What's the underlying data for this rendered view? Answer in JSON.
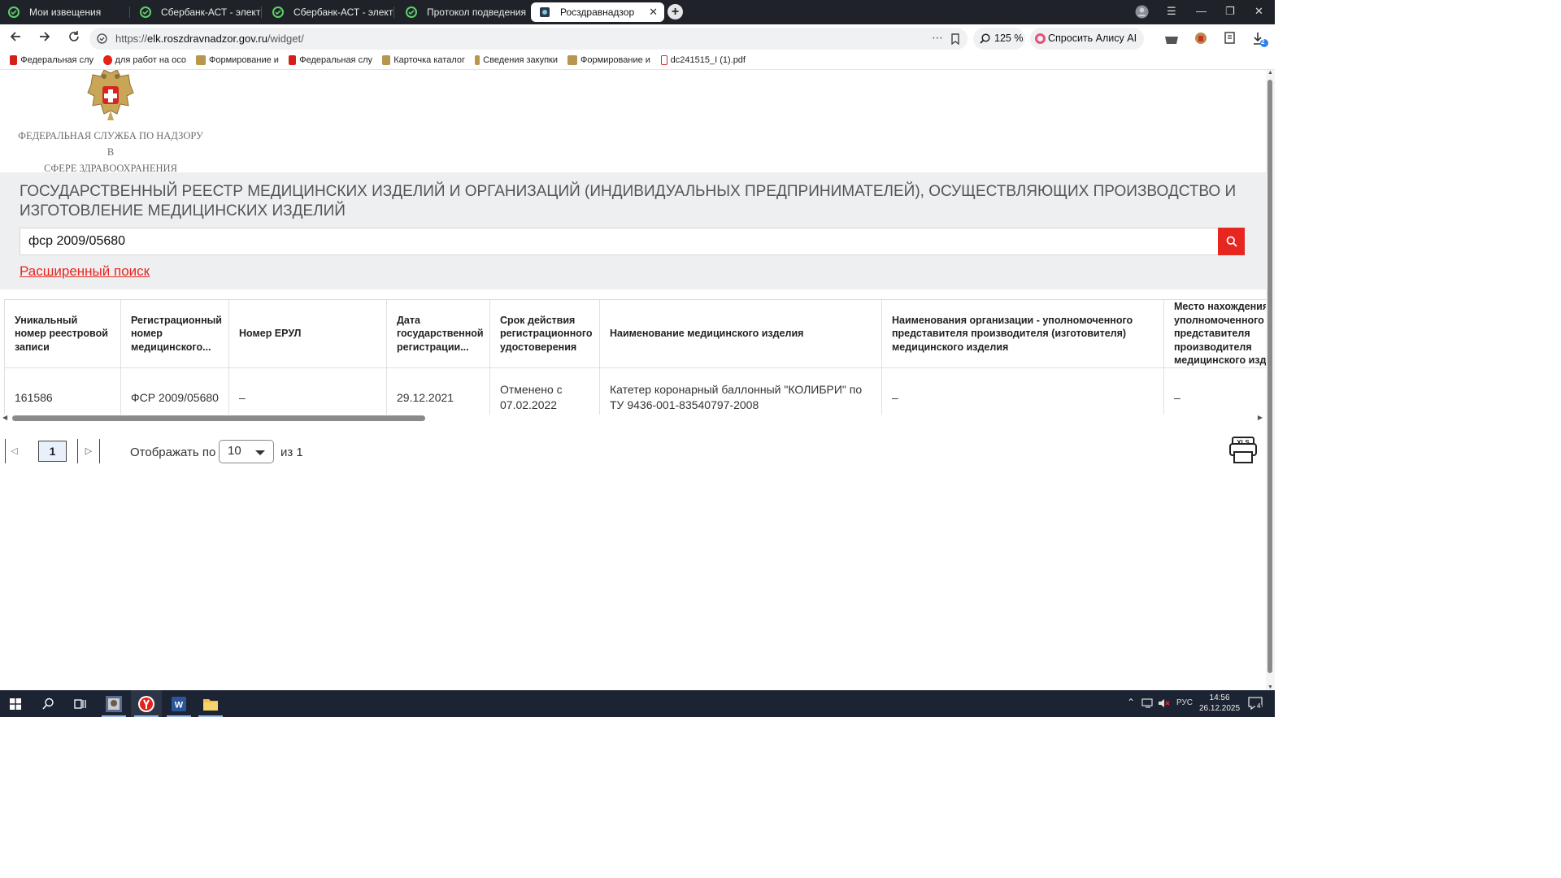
{
  "browser": {
    "tabs": [
      {
        "title": "Мои извещения",
        "active": false
      },
      {
        "title": "Сбербанк-АСТ - электрон",
        "active": false
      },
      {
        "title": "Сбербанк-АСТ - электрон",
        "active": false
      },
      {
        "title": "Протокол подведения ит",
        "active": false
      },
      {
        "title": "Росздравнадзор",
        "active": true
      }
    ],
    "url_prefix": "https://",
    "url_host": "elk.roszdravnadzor.gov.ru",
    "url_path": "/widget/",
    "zoom": "125 %",
    "alice_label": "Спросить Алису AI",
    "downloads_badge": "2",
    "bookmarks": [
      "Федеральная слу",
      "для работ на осо",
      "Формирование и",
      "Федеральная слу",
      "Карточка каталог",
      "Сведения закупки",
      "Формирование и",
      "dc241515_I (1).pdf"
    ]
  },
  "site": {
    "org_name_line1": "Федеральная служба по надзору в",
    "org_name_line2": "сфере здравоохранения",
    "registry_title": "Государственный реестр медицинских изделий и организаций (индивидуальных предпринимателей), осуществляющих производство и изготовление медицинских изделий",
    "search_value": "фср 2009/05680",
    "advanced_search": "Расширенный поиск"
  },
  "table": {
    "headers": [
      "Уникальный номер реестровой записи",
      "Регистрационный номер медицинского...",
      "Номер ЕРУЛ",
      "Дата государственной регистрации...",
      "Срок действия регистрационного удостоверения",
      "Наименование медицинского изделия",
      "Наименования организации - уполномоченного представителя производителя (изготовителя) медицинского изделия",
      "Место нахождения уполномоченного представителя производителя медицинского изделия"
    ],
    "rows": [
      [
        "161586",
        "ФСР 2009/05680",
        "–",
        "29.12.2021",
        "Отменено с 07.02.2022",
        "Катетер коронарный баллонный \"КОЛИБРИ\" по ТУ 9436-001-83540797-2008",
        "–",
        "–"
      ]
    ]
  },
  "pagination": {
    "current_page": "1",
    "per_page_label": "Отображать по",
    "per_page_value": "10",
    "of_label": "из 1",
    "export_label": "XLS"
  },
  "taskbar": {
    "lang": "РУС",
    "time": "14:56",
    "date": "26.12.2025",
    "notifications": "4"
  },
  "colors": {
    "accent_red": "#e6261f",
    "band_grey": "#eeeff1",
    "tabbar": "#1f2329",
    "taskbar": "#1c2433"
  }
}
